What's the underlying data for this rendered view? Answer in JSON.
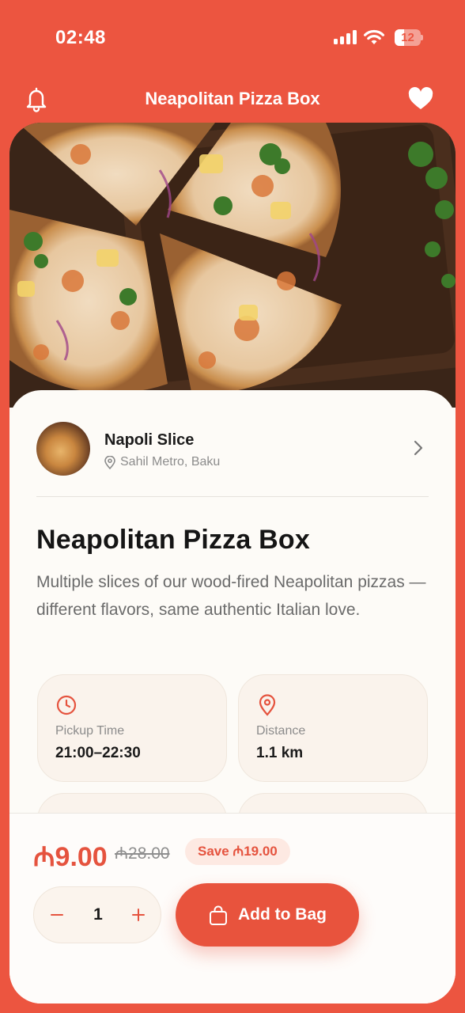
{
  "status_bar": {
    "time": "02:48",
    "battery": "12"
  },
  "header": {
    "title": "Neapolitan Pizza Box"
  },
  "vendor": {
    "name": "Napoli Slice",
    "location": "Sahil Metro, Baku"
  },
  "product": {
    "title": "Neapolitan Pizza Box",
    "description": "Multiple slices of our wood-fired Neapolitan pizzas — different flavors, same authentic Italian love."
  },
  "info_cards": [
    {
      "icon": "clock-icon",
      "label": "Pickup Time",
      "value": "21:00–22:30"
    },
    {
      "icon": "map-pin-icon",
      "label": "Distance",
      "value": "1.1 km"
    }
  ],
  "pricing": {
    "price": "₼9.00",
    "old_price": "₼28.00",
    "save_label": "Save ₼19.00"
  },
  "cart": {
    "quantity": "1",
    "add_label": "Add to Bag"
  },
  "colors": {
    "accent": "#ec5540",
    "card_bg": "#fdfbf7",
    "chip_bg": "#faf3ec"
  }
}
